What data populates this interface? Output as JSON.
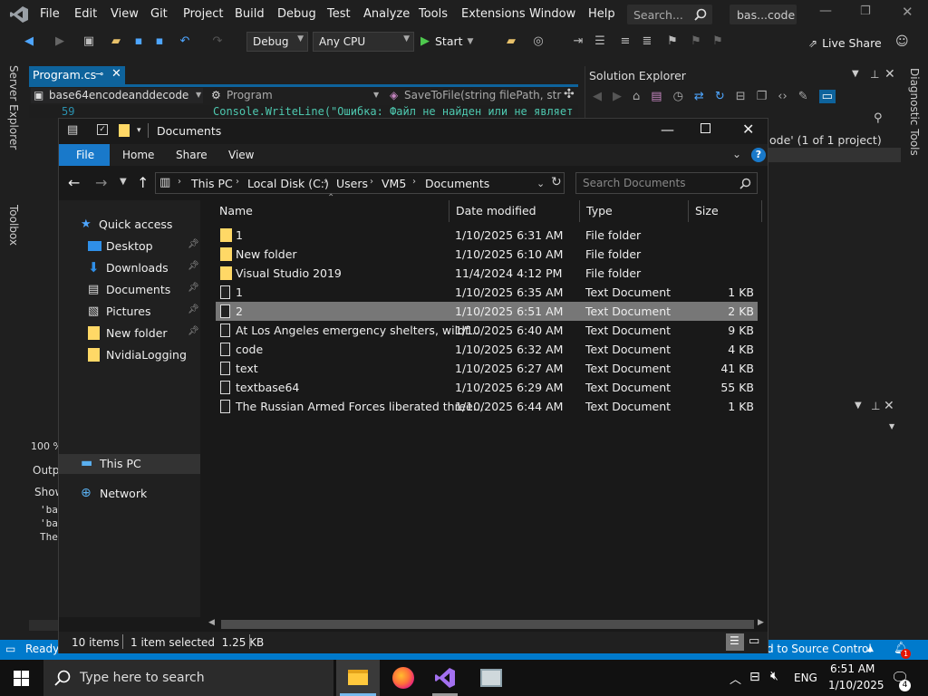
{
  "vs": {
    "menu": [
      "File",
      "Edit",
      "View",
      "Git",
      "Project",
      "Build",
      "Debug",
      "Test",
      "Analyze",
      "Tools",
      "Extensions",
      "Window",
      "Help"
    ],
    "search_placeholder": "Search...",
    "solution_name": "bas...code",
    "config": "Debug",
    "platform": "Any CPU",
    "start_label": "Start",
    "live_share": "Live Share",
    "doc_tab": "Program.cs",
    "nav_project": "base64encodeanddecode",
    "nav_class": "Program",
    "nav_member": "SaveToFile(string filePath, strir",
    "code_line_no": "59",
    "code_line": "Console.WriteLine(\"Ошибка: Файл не найден или не являет",
    "left_tabs": [
      "Server Explorer",
      "Toolbox"
    ],
    "right_tab": "Diagnostic Tools",
    "solution_explorer_title": "Solution Explorer",
    "solution_text": "ode' (1 of 1 project)",
    "zoom": "100 %",
    "output_title": "Outp",
    "output_show": "Show",
    "output_lines": [
      "'ba",
      "'ba",
      "The"
    ],
    "status_ready": "Ready",
    "status_source": "d to Source Control",
    "notif_count": "1"
  },
  "fe": {
    "title": "Documents",
    "ribbon_tabs": [
      "File",
      "Home",
      "Share",
      "View"
    ],
    "breadcrumb": [
      "This PC",
      "Local Disk (C:)",
      "Users",
      "VM5",
      "Documents"
    ],
    "search_placeholder": "Search Documents",
    "columns": [
      "Name",
      "Date modified",
      "Type",
      "Size"
    ],
    "nav_items": [
      {
        "label": "Quick access",
        "icon": "star-icon"
      },
      {
        "label": "Desktop",
        "icon": "desktop-icon"
      },
      {
        "label": "Downloads",
        "icon": "download-icon"
      },
      {
        "label": "Documents",
        "icon": "document-icon"
      },
      {
        "label": "Pictures",
        "icon": "pictures-icon"
      },
      {
        "label": "New folder",
        "icon": "folder-icon"
      },
      {
        "label": "NvidiaLogging",
        "icon": "folder-icon"
      },
      {
        "label": "This PC",
        "icon": "pc-icon"
      },
      {
        "label": "Network",
        "icon": "network-icon"
      }
    ],
    "files": [
      {
        "name": "1",
        "date": "1/10/2025 6:31 AM",
        "type": "File folder",
        "size": "",
        "kind": "folder"
      },
      {
        "name": "New folder",
        "date": "1/10/2025 6:10 AM",
        "type": "File folder",
        "size": "",
        "kind": "folder"
      },
      {
        "name": "Visual Studio 2019",
        "date": "11/4/2024 4:12 PM",
        "type": "File folder",
        "size": "",
        "kind": "folder"
      },
      {
        "name": "1",
        "date": "1/10/2025 6:35 AM",
        "type": "Text Document",
        "size": "1 KB",
        "kind": "text"
      },
      {
        "name": "2",
        "date": "1/10/2025 6:51 AM",
        "type": "Text Document",
        "size": "2 KB",
        "kind": "text",
        "selected": true
      },
      {
        "name": "At Los Angeles emergency shelters, wildf...",
        "date": "1/10/2025 6:40 AM",
        "type": "Text Document",
        "size": "9 KB",
        "kind": "text"
      },
      {
        "name": "code",
        "date": "1/10/2025 6:32 AM",
        "type": "Text Document",
        "size": "4 KB",
        "kind": "text"
      },
      {
        "name": "text",
        "date": "1/10/2025 6:27 AM",
        "type": "Text Document",
        "size": "41 KB",
        "kind": "text"
      },
      {
        "name": "textbase64",
        "date": "1/10/2025 6:29 AM",
        "type": "Text Document",
        "size": "55 KB",
        "kind": "text"
      },
      {
        "name": "The Russian Armed Forces liberated three...",
        "date": "1/10/2025 6:44 AM",
        "type": "Text Document",
        "size": "1 KB",
        "kind": "text"
      }
    ],
    "status_items": "10 items",
    "status_selected": "1 item selected  1.25 KB"
  },
  "taskbar": {
    "search_placeholder": "Type here to search",
    "lang": "ENG",
    "time": "6:51 AM",
    "date": "1/10/2025",
    "notif_badge": "4"
  },
  "colors": {
    "accent": "#0078d7",
    "vs_purple": "#68217a",
    "selected_row": "#777777",
    "folder": "#ffd866"
  }
}
